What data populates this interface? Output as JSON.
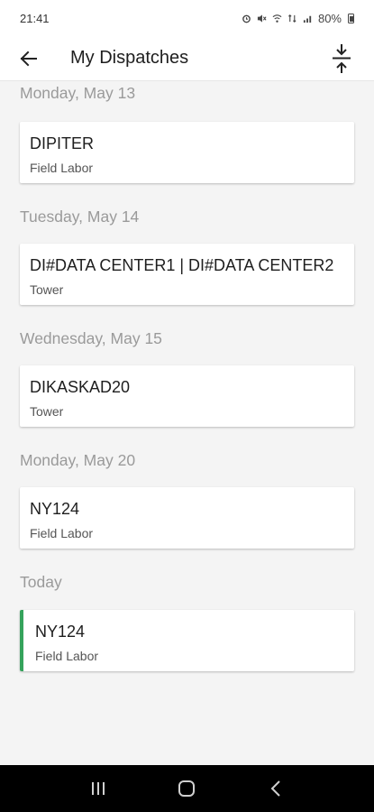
{
  "status_bar": {
    "time": "21:41",
    "battery": "80%"
  },
  "app_bar": {
    "title": "My Dispatches",
    "back_icon": "arrow-left-icon",
    "collapse_icon": "collapse-vertical-icon"
  },
  "groups": [
    {
      "date": "Monday, May 13",
      "title": "DIPITER",
      "subtitle": "Field Labor"
    },
    {
      "date": "Tuesday, May 14",
      "title": "DI#DATA CENTER1 | DI#DATA CENTER2",
      "subtitle": "Tower"
    },
    {
      "date": "Wednesday, May 15",
      "title": "DIKASKAD20",
      "subtitle": "Tower"
    },
    {
      "date": "Monday, May 20",
      "title": "NY124",
      "subtitle": "Field Labor"
    },
    {
      "date": "Today",
      "title": "NY124",
      "subtitle": "Field Labor"
    }
  ],
  "colors": {
    "today_accent": "#35a35c",
    "date_header": "#9a9a9a",
    "background": "#f4f4f4"
  },
  "nav_bar": {
    "recents_icon": "recents-icon",
    "home_icon": "home-icon",
    "back_icon": "back-chevron-icon"
  }
}
